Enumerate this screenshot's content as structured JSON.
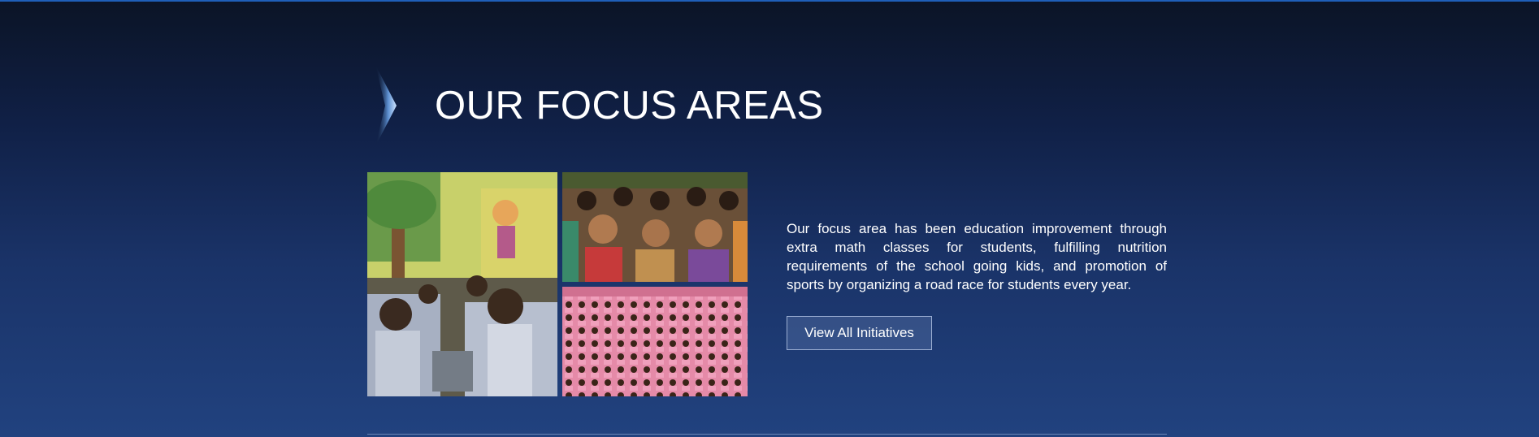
{
  "section": {
    "title": "OUR FOCUS AREAS",
    "description": "Our focus area has been education improvement through extra math classes for students, fulfilling nutrition requirements of the school going kids, and promotion of sports by organizing a road race for students every year.",
    "cta_label": "View All Initiatives"
  },
  "photos": [
    {
      "subject": "classroom-students-photo"
    },
    {
      "subject": "girls-raising-hands-photo"
    },
    {
      "subject": "crowd-of-children-photo"
    }
  ],
  "colors": {
    "background_top": "#0b1426",
    "background_bottom": "#21427f",
    "accent_line": "#1f5fb8",
    "text": "#ffffff"
  }
}
